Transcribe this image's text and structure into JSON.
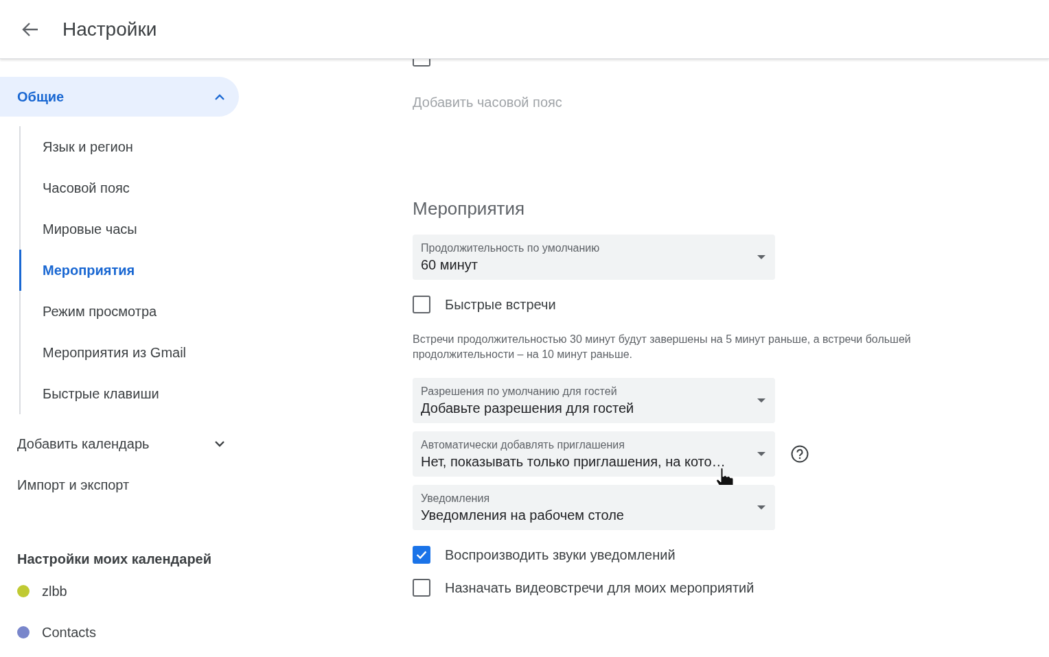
{
  "header": {
    "title": "Настройки"
  },
  "sidebar": {
    "items": [
      {
        "label": "Общие",
        "selected": true,
        "expanded": true,
        "children": [
          {
            "label": "Язык и регион",
            "selected": false
          },
          {
            "label": "Часовой пояс",
            "selected": false
          },
          {
            "label": "Мировые часы",
            "selected": false
          },
          {
            "label": "Мероприятия",
            "selected": true
          },
          {
            "label": "Режим просмотра",
            "selected": false
          },
          {
            "label": "Мероприятия из Gmail",
            "selected": false
          },
          {
            "label": "Быстрые клавиши",
            "selected": false
          }
        ]
      },
      {
        "label": "Добавить календарь",
        "selected": false,
        "expanded": false
      },
      {
        "label": "Импорт и экспорт",
        "selected": false
      }
    ],
    "calendars_heading": "Настройки моих календарей",
    "calendars": [
      {
        "name": "zlbb",
        "color": "#c0ca33"
      },
      {
        "name": "Contacts",
        "color": "#7986cb"
      }
    ]
  },
  "content": {
    "world_clock": {
      "checked": false
    },
    "add_timezone": {
      "label": "Добавить часовой пояс",
      "disabled": true
    },
    "section_title": "Мероприятия",
    "controls": [
      {
        "kind": "select",
        "label": "Продолжительность по умолчанию",
        "value": "60 минут",
        "help": false
      },
      {
        "kind": "checkbox",
        "label": "Быстрые встречи",
        "checked": false
      },
      {
        "kind": "note",
        "text": "Встречи продолжительностью 30 минут будут завершены на 5 минут раньше, а встречи большей продолжительности – на 10 минут раньше."
      },
      {
        "kind": "select",
        "label": "Разрешения по умолчанию для гостей",
        "value": "Добавьте разрешения для гостей",
        "help": false
      },
      {
        "kind": "select",
        "label": "Автоматически добавлять приглашения",
        "value": "Нет, показывать только приглашения, на кото…",
        "help": true
      },
      {
        "kind": "select",
        "label": "Уведомления",
        "value": "Уведомления на рабочем столе",
        "help": false
      },
      {
        "kind": "checkbox",
        "label": "Воспроизводить звуки уведомлений",
        "checked": true
      },
      {
        "kind": "checkbox",
        "label": "Назначать видеовстречи для моих мероприятий",
        "checked": false
      }
    ]
  }
}
